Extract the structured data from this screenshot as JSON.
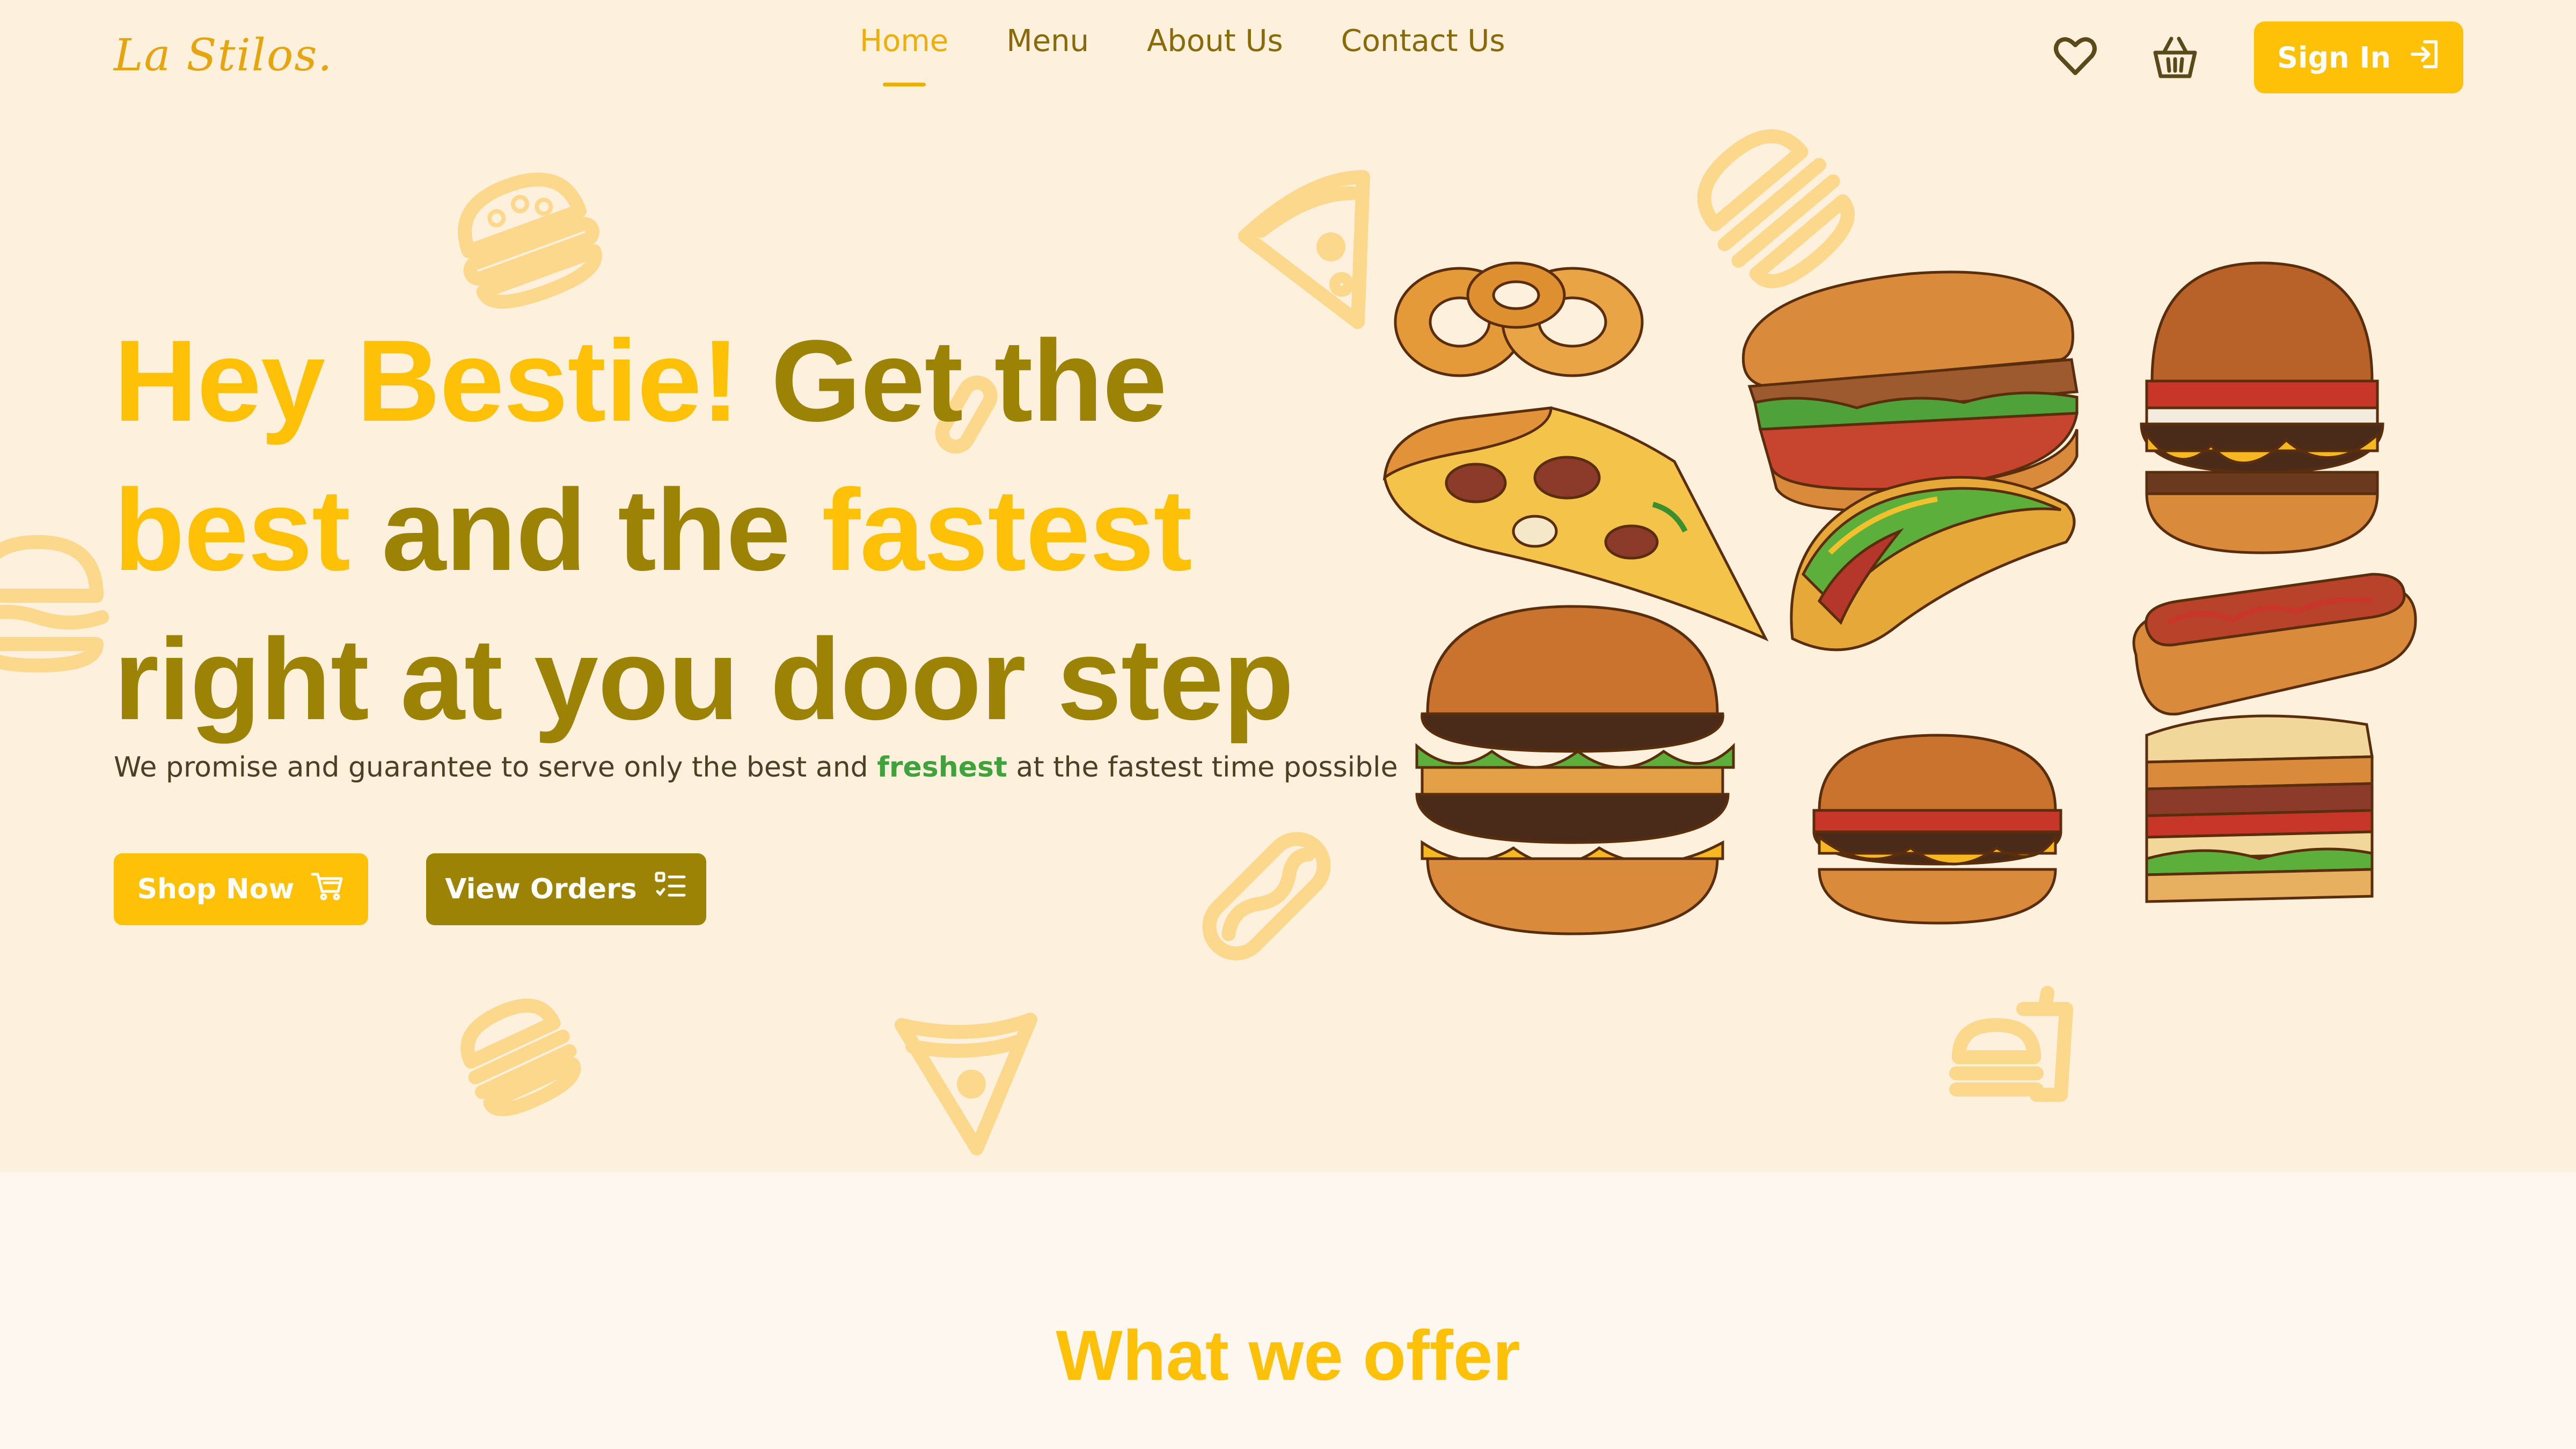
{
  "brand": {
    "logo": "La Stilos."
  },
  "nav": {
    "items": [
      {
        "label": "Home",
        "active": true
      },
      {
        "label": "Menu",
        "active": false
      },
      {
        "label": "About Us",
        "active": false
      },
      {
        "label": "Contact Us",
        "active": false
      }
    ],
    "icons": {
      "wishlist": "heart-icon",
      "basket": "basket-icon"
    },
    "signin_label": "Sign In"
  },
  "hero": {
    "headline": {
      "line1_highlight": "Hey Bestie!",
      "line1_rest": " Get the",
      "line2_highlight1": "best",
      "line2_mid": " and the ",
      "line2_highlight2": "fastest",
      "line3": "right at you door step"
    },
    "subtitle": {
      "before": "We promise and guarantee to serve only the best and ",
      "highlight": "freshest",
      "after": " at the fastest time possible"
    },
    "shop_label": "Shop Now",
    "orders_label": "View Orders",
    "illustration": "fast-food-collage-illustration"
  },
  "offer": {
    "title": "What we offer"
  },
  "colors": {
    "background": "#FDF0DC",
    "section_background": "#FEF7EF",
    "accent_yellow": "#FFC107",
    "olive": "#9C8205",
    "green_highlight": "#3FA23A",
    "doodle": "#FBD88C"
  }
}
